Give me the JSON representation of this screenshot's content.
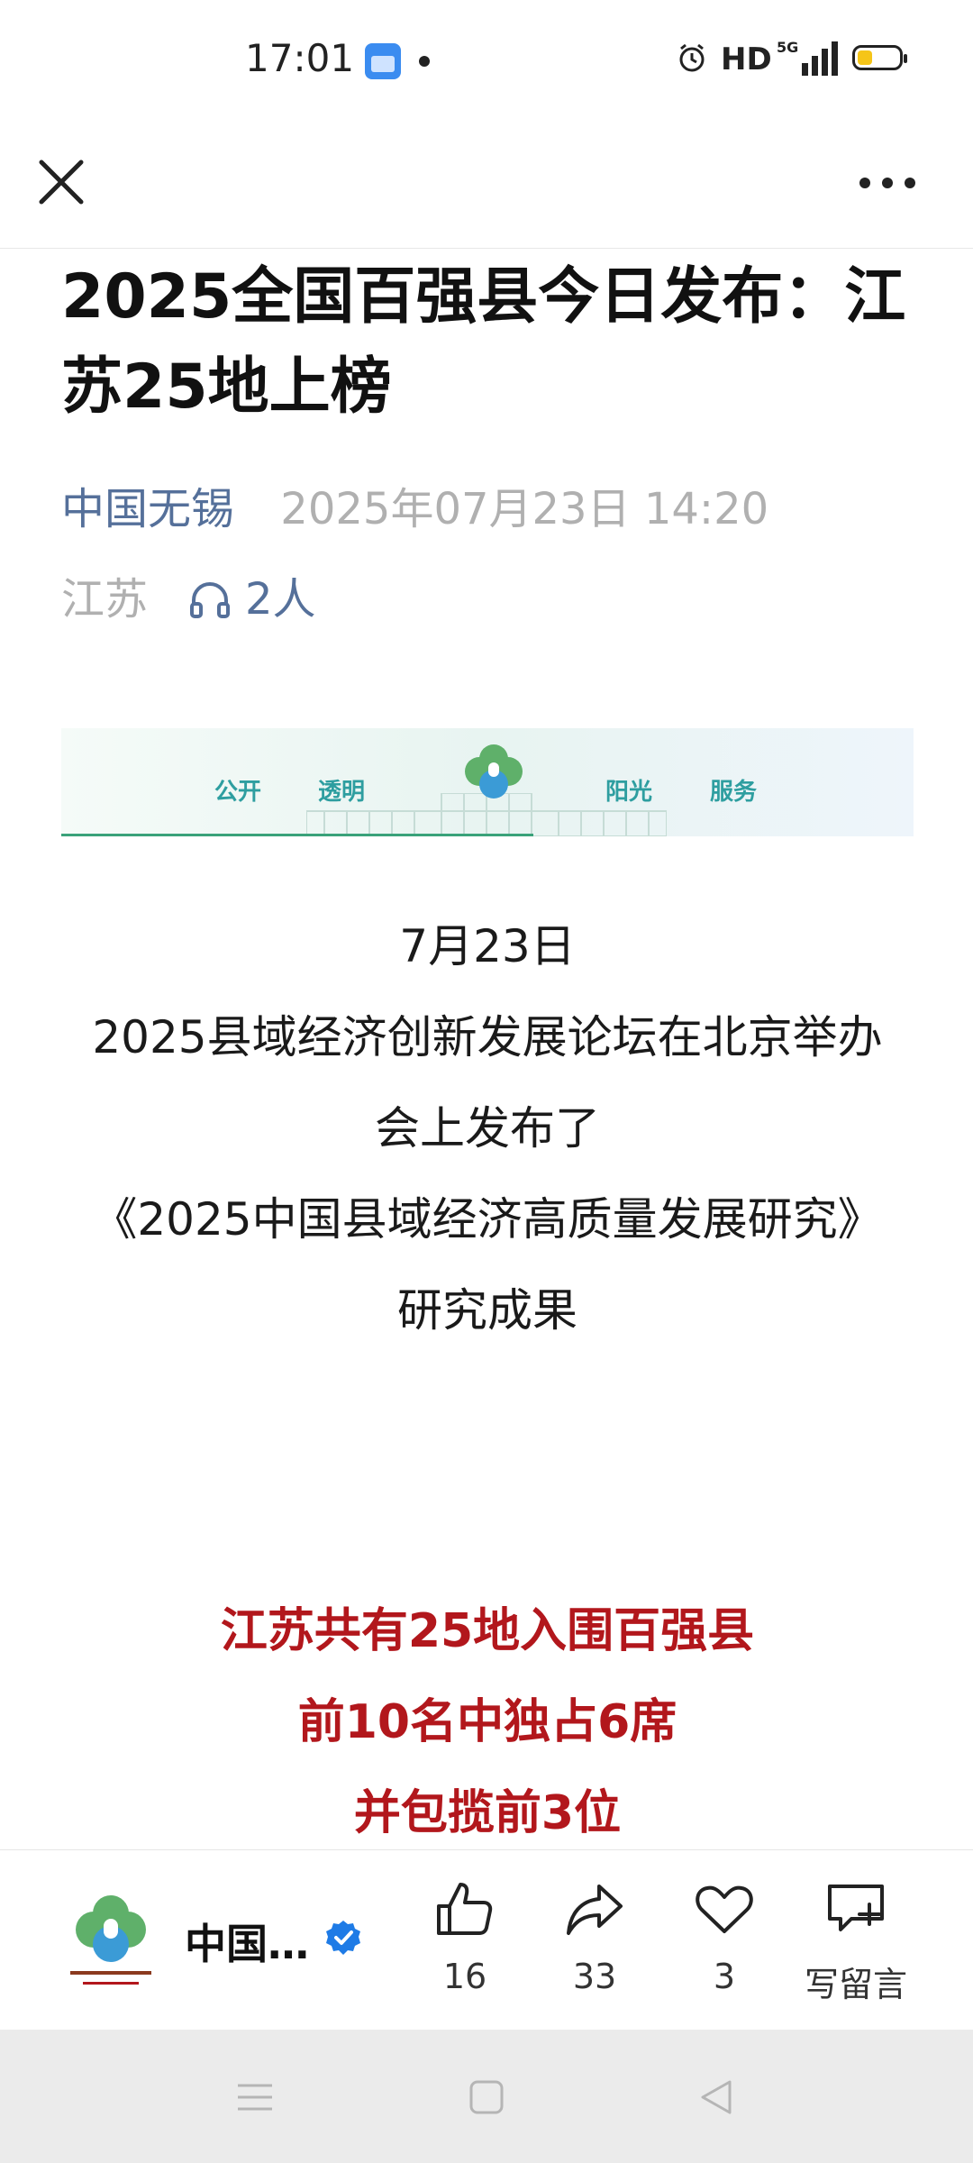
{
  "status_bar": {
    "time": "17:01",
    "indicator": "HD",
    "network": "5G"
  },
  "nav": {
    "close_icon": "close-icon",
    "more_icon": "more-icon"
  },
  "article": {
    "title": "2025全国百强县今日发布：江苏25地上榜",
    "source": "中国无锡",
    "datetime": "2025年07月23日 14:20",
    "region": "江苏",
    "listeners": "2人",
    "banner": {
      "words": [
        "公开",
        "透明",
        "阳光",
        "服务"
      ]
    },
    "paragraphs": [
      "7月23日",
      "2025县域经济创新发展论坛在北京举办",
      "会上发布了",
      "《2025中国县域经济高质量发展研究》",
      "研究成果"
    ],
    "highlights": [
      "江苏共有25地入围百强县",
      "前10名中独占6席",
      "并包揽前3位"
    ]
  },
  "action_bar": {
    "author_name": "中国…",
    "like_count": "16",
    "share_count": "33",
    "favorite_count": "3",
    "comment_label": "写留言"
  },
  "colors": {
    "accent_link": "#55709a",
    "highlight_red": "#b2171c",
    "banner_teal": "#2e9ea0",
    "verified_blue": "#1e7be6"
  }
}
